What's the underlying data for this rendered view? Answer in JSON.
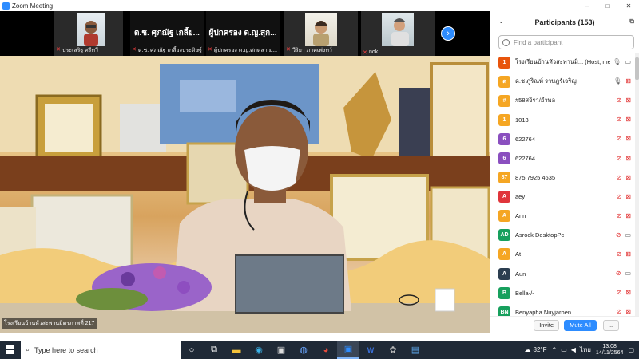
{
  "window": {
    "title": "Zoom Meeting",
    "minimize": "–",
    "maximize": "□",
    "close": "✕"
  },
  "gallery": {
    "tiles": [
      {
        "name": "ประเสริฐ ศรีทวี",
        "big": ""
      },
      {
        "name": "ด.ช. ศุภณัฐ เกลี้ยงประดิษฐ์",
        "big": "ด.ช. ศุภณัฐ  เกลี้ย..."
      },
      {
        "name": "ผู้ปกครอง ด.ญ.ศกตลา ม...",
        "big": "ผู้ปกครอง ด.ญ.สุก..."
      },
      {
        "name": "วีริยา ภาคเพ่งทว์",
        "big": ""
      },
      {
        "name": "nok",
        "big": ""
      }
    ],
    "next_icon": "chevron-right-icon"
  },
  "main_video": {
    "speaker_label": "โรงเรียนบ้านหัวสะพานมิตรภาพที่ 217"
  },
  "participants": {
    "title": "Participants (153)",
    "search_placeholder": "Find a participant",
    "items": [
      {
        "initial": "1",
        "color": "#e8540c",
        "name": "โรงเรียนบ้านหัวสะพานมิ... (Host, me)",
        "mic": "on",
        "video": "on"
      },
      {
        "initial": "ด",
        "color": "#f5a623",
        "name": "ด.ช ภูริณท์  ราษฎร์เจริญ",
        "mic": "on",
        "video": "off"
      },
      {
        "initial": "#",
        "color": "#f5a623",
        "name": "#58สจิรา/อำพล",
        "mic": "off",
        "video": "off"
      },
      {
        "initial": "1",
        "color": "#f5a623",
        "name": "1013",
        "mic": "off",
        "video": "off"
      },
      {
        "initial": "6",
        "color": "#8a4fbf",
        "name": "622764",
        "mic": "off",
        "video": "off"
      },
      {
        "initial": "6",
        "color": "#8a4fbf",
        "name": "622764",
        "mic": "off",
        "video": "off"
      },
      {
        "initial": "87",
        "color": "#f5a623",
        "name": "875 7925 4635",
        "mic": "off",
        "video": "off"
      },
      {
        "initial": "A",
        "color": "#e0353b",
        "name": "aey",
        "mic": "off",
        "video": "off"
      },
      {
        "initial": "A",
        "color": "#f5a623",
        "name": "Ann",
        "mic": "off",
        "video": "off"
      },
      {
        "initial": "AD",
        "color": "#17a05d",
        "name": "Asrock  DesktopPc",
        "mic": "off",
        "video": "on"
      },
      {
        "initial": "A",
        "color": "#f5a623",
        "name": "At",
        "mic": "off",
        "video": "off"
      },
      {
        "initial": "A",
        "color": "#2c3e50",
        "name": "Aun",
        "mic": "off",
        "video": "on"
      },
      {
        "initial": "B",
        "color": "#17a05d",
        "name": "Bella-/-",
        "mic": "off",
        "video": "off"
      },
      {
        "initial": "BN",
        "color": "#17a05d",
        "name": "Benyapha Nuyjaroen.",
        "mic": "off",
        "video": "off"
      }
    ],
    "invite_label": "Invite",
    "mute_all_label": "Mute All",
    "more_label": "..."
  },
  "taskbar": {
    "search_placeholder": "Type here to search",
    "weather": "82°F",
    "lang": "ไทย",
    "time": "13:08",
    "date": "14/11/2564"
  }
}
